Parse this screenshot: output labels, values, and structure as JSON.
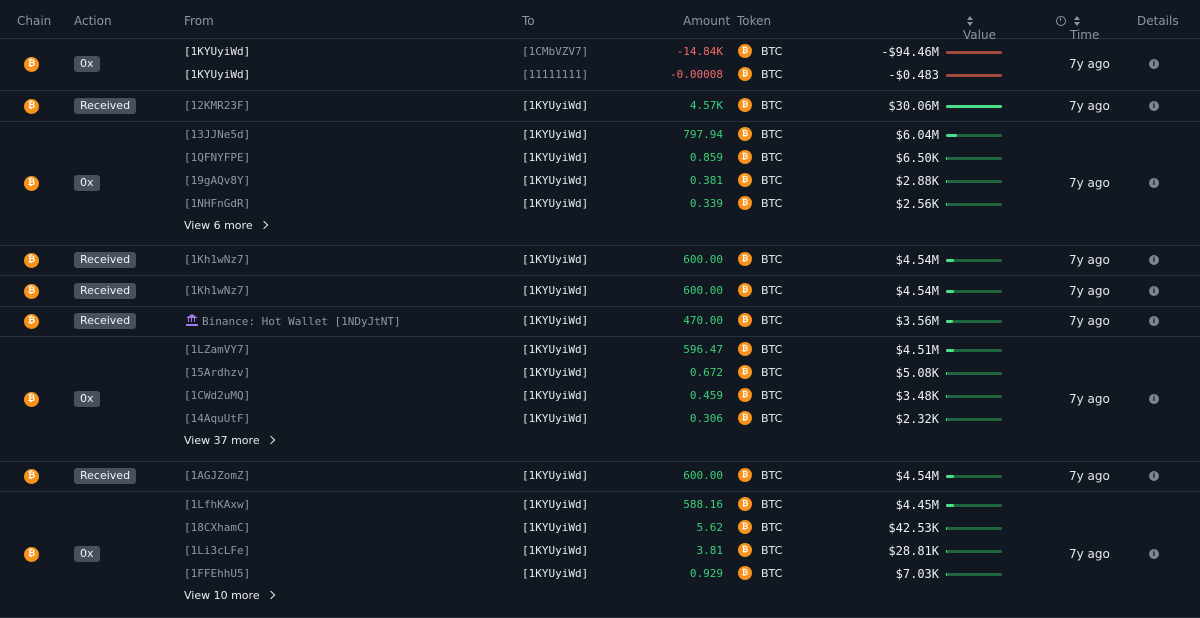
{
  "headers": {
    "chain": "Chain",
    "action": "Action",
    "from": "From",
    "to": "To",
    "amount": "Amount",
    "token": "Token",
    "value": "Value",
    "time": "Time",
    "details": "Details"
  },
  "rows": [
    {
      "action": "0x",
      "time": "7y ago",
      "items": [
        {
          "from": "[1KYUyiWd]",
          "to": "[1CMbVZV7]",
          "amount": "-14.84K",
          "token": "BTC",
          "value": "-$94.46M"
        },
        {
          "from": "[1KYUyiWd]",
          "to": "[11111111]",
          "amount": "-0.00008",
          "token": "BTC",
          "value": "-$0.483"
        }
      ]
    },
    {
      "action": "Received",
      "time": "7y ago",
      "items": [
        {
          "from": "[12KMR23F]",
          "to": "[1KYUyiWd]",
          "amount": "4.57K",
          "token": "BTC",
          "value": "$30.06M"
        }
      ]
    },
    {
      "action": "0x",
      "time": "7y ago",
      "more": "View 6 more",
      "items": [
        {
          "from": "[13JJNe5d]",
          "to": "[1KYUyiWd]",
          "amount": "797.94",
          "token": "BTC",
          "value": "$6.04M"
        },
        {
          "from": "[1QFNYFPE]",
          "to": "[1KYUyiWd]",
          "amount": "0.859",
          "token": "BTC",
          "value": "$6.50K"
        },
        {
          "from": "[19gAQv8Y]",
          "to": "[1KYUyiWd]",
          "amount": "0.381",
          "token": "BTC",
          "value": "$2.88K"
        },
        {
          "from": "[1NHFnGdR]",
          "to": "[1KYUyiWd]",
          "amount": "0.339",
          "token": "BTC",
          "value": "$2.56K"
        }
      ]
    },
    {
      "action": "Received",
      "time": "7y ago",
      "items": [
        {
          "from": "[1Kh1wNz7]",
          "to": "[1KYUyiWd]",
          "amount": "600.00",
          "token": "BTC",
          "value": "$4.54M"
        }
      ]
    },
    {
      "action": "Received",
      "time": "7y ago",
      "items": [
        {
          "from": "[1Kh1wNz7]",
          "to": "[1KYUyiWd]",
          "amount": "600.00",
          "token": "BTC",
          "value": "$4.54M"
        }
      ]
    },
    {
      "action": "Received",
      "time": "7y ago",
      "items": [
        {
          "from": "Binance: Hot Wallet [1NDyJtNT]",
          "to": "[1KYUyiWd]",
          "amount": "470.00",
          "token": "BTC",
          "value": "$3.56M"
        }
      ]
    },
    {
      "action": "0x",
      "time": "7y ago",
      "more": "View 37 more",
      "items": [
        {
          "from": "[1LZamVY7]",
          "to": "[1KYUyiWd]",
          "amount": "596.47",
          "token": "BTC",
          "value": "$4.51M"
        },
        {
          "from": "[15Ardhzv]",
          "to": "[1KYUyiWd]",
          "amount": "0.672",
          "token": "BTC",
          "value": "$5.08K"
        },
        {
          "from": "[1CWd2uMQ]",
          "to": "[1KYUyiWd]",
          "amount": "0.459",
          "token": "BTC",
          "value": "$3.48K"
        },
        {
          "from": "[14AquUtF]",
          "to": "[1KYUyiWd]",
          "amount": "0.306",
          "token": "BTC",
          "value": "$2.32K"
        }
      ]
    },
    {
      "action": "Received",
      "time": "7y ago",
      "items": [
        {
          "from": "[1AGJZomZ]",
          "to": "[1KYUyiWd]",
          "amount": "600.00",
          "token": "BTC",
          "value": "$4.54M"
        }
      ]
    },
    {
      "action": "0x",
      "time": "7y ago",
      "more": "View 10 more",
      "items": [
        {
          "from": "[1LfhKAxw]",
          "to": "[1KYUyiWd]",
          "amount": "588.16",
          "token": "BTC",
          "value": "$4.45M"
        },
        {
          "from": "[18CXhamC]",
          "to": "[1KYUyiWd]",
          "amount": "5.62",
          "token": "BTC",
          "value": "$42.53K"
        },
        {
          "from": "[1Li3cLFe]",
          "to": "[1KYUyiWd]",
          "amount": "3.81",
          "token": "BTC",
          "value": "$28.81K"
        },
        {
          "from": "[1FFEhhU5]",
          "to": "[1KYUyiWd]",
          "amount": "0.929",
          "token": "BTC",
          "value": "$7.03K"
        }
      ]
    }
  ]
}
